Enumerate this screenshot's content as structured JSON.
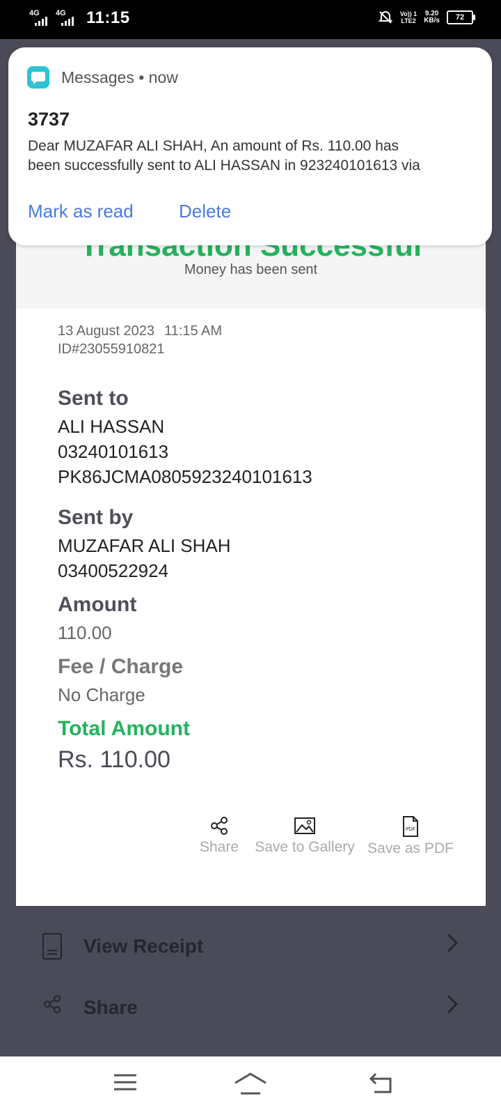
{
  "status_bar": {
    "network1": "4G",
    "network2": "4G",
    "time": "11:15",
    "volte_line1": "Vo)) 1",
    "volte_line2": "LTE2",
    "speed_value": "9.20",
    "speed_unit": "KB/s",
    "battery": "72"
  },
  "notification": {
    "app_name": "Messages",
    "separator": "•",
    "time": "now",
    "sender": "3737",
    "line1": "Dear MUZAFAR ALI SHAH, An amount of Rs. 110.00 has",
    "line2": "been successfully sent to ALI HASSAN in 923240101613 via",
    "mark_read": "Mark as read",
    "delete": "Delete"
  },
  "receipt": {
    "headline": "Transaction Successful",
    "subheadline": "Money has been sent",
    "date": "13 August 2023",
    "time": "11:15 AM",
    "txn_id": "ID#23055910821",
    "sent_to_label": "Sent to",
    "sent_to_name": "ALI HASSAN",
    "sent_to_number": "03240101613",
    "sent_to_iban": "PK86JCMA0805923240101613",
    "sent_by_label": "Sent by",
    "sent_by_name": "MUZAFAR ALI SHAH",
    "sent_by_number": "03400522924",
    "amount_label": "Amount",
    "amount_value": "110.00",
    "fee_label": "Fee / Charge",
    "fee_value": "No Charge",
    "total_label": "Total Amount",
    "total_value": "Rs.  110.00",
    "actions": {
      "share": "Share",
      "save_gallery": "Save to Gallery",
      "save_pdf": "Save as PDF",
      "pdf_icon_text": "PDF"
    }
  },
  "menu": {
    "view_receipt": "View Receipt",
    "share": "Share"
  },
  "colors": {
    "accent_green": "#25b25c",
    "link_blue": "#4a7ae0",
    "overlay": "#4a4a58"
  }
}
